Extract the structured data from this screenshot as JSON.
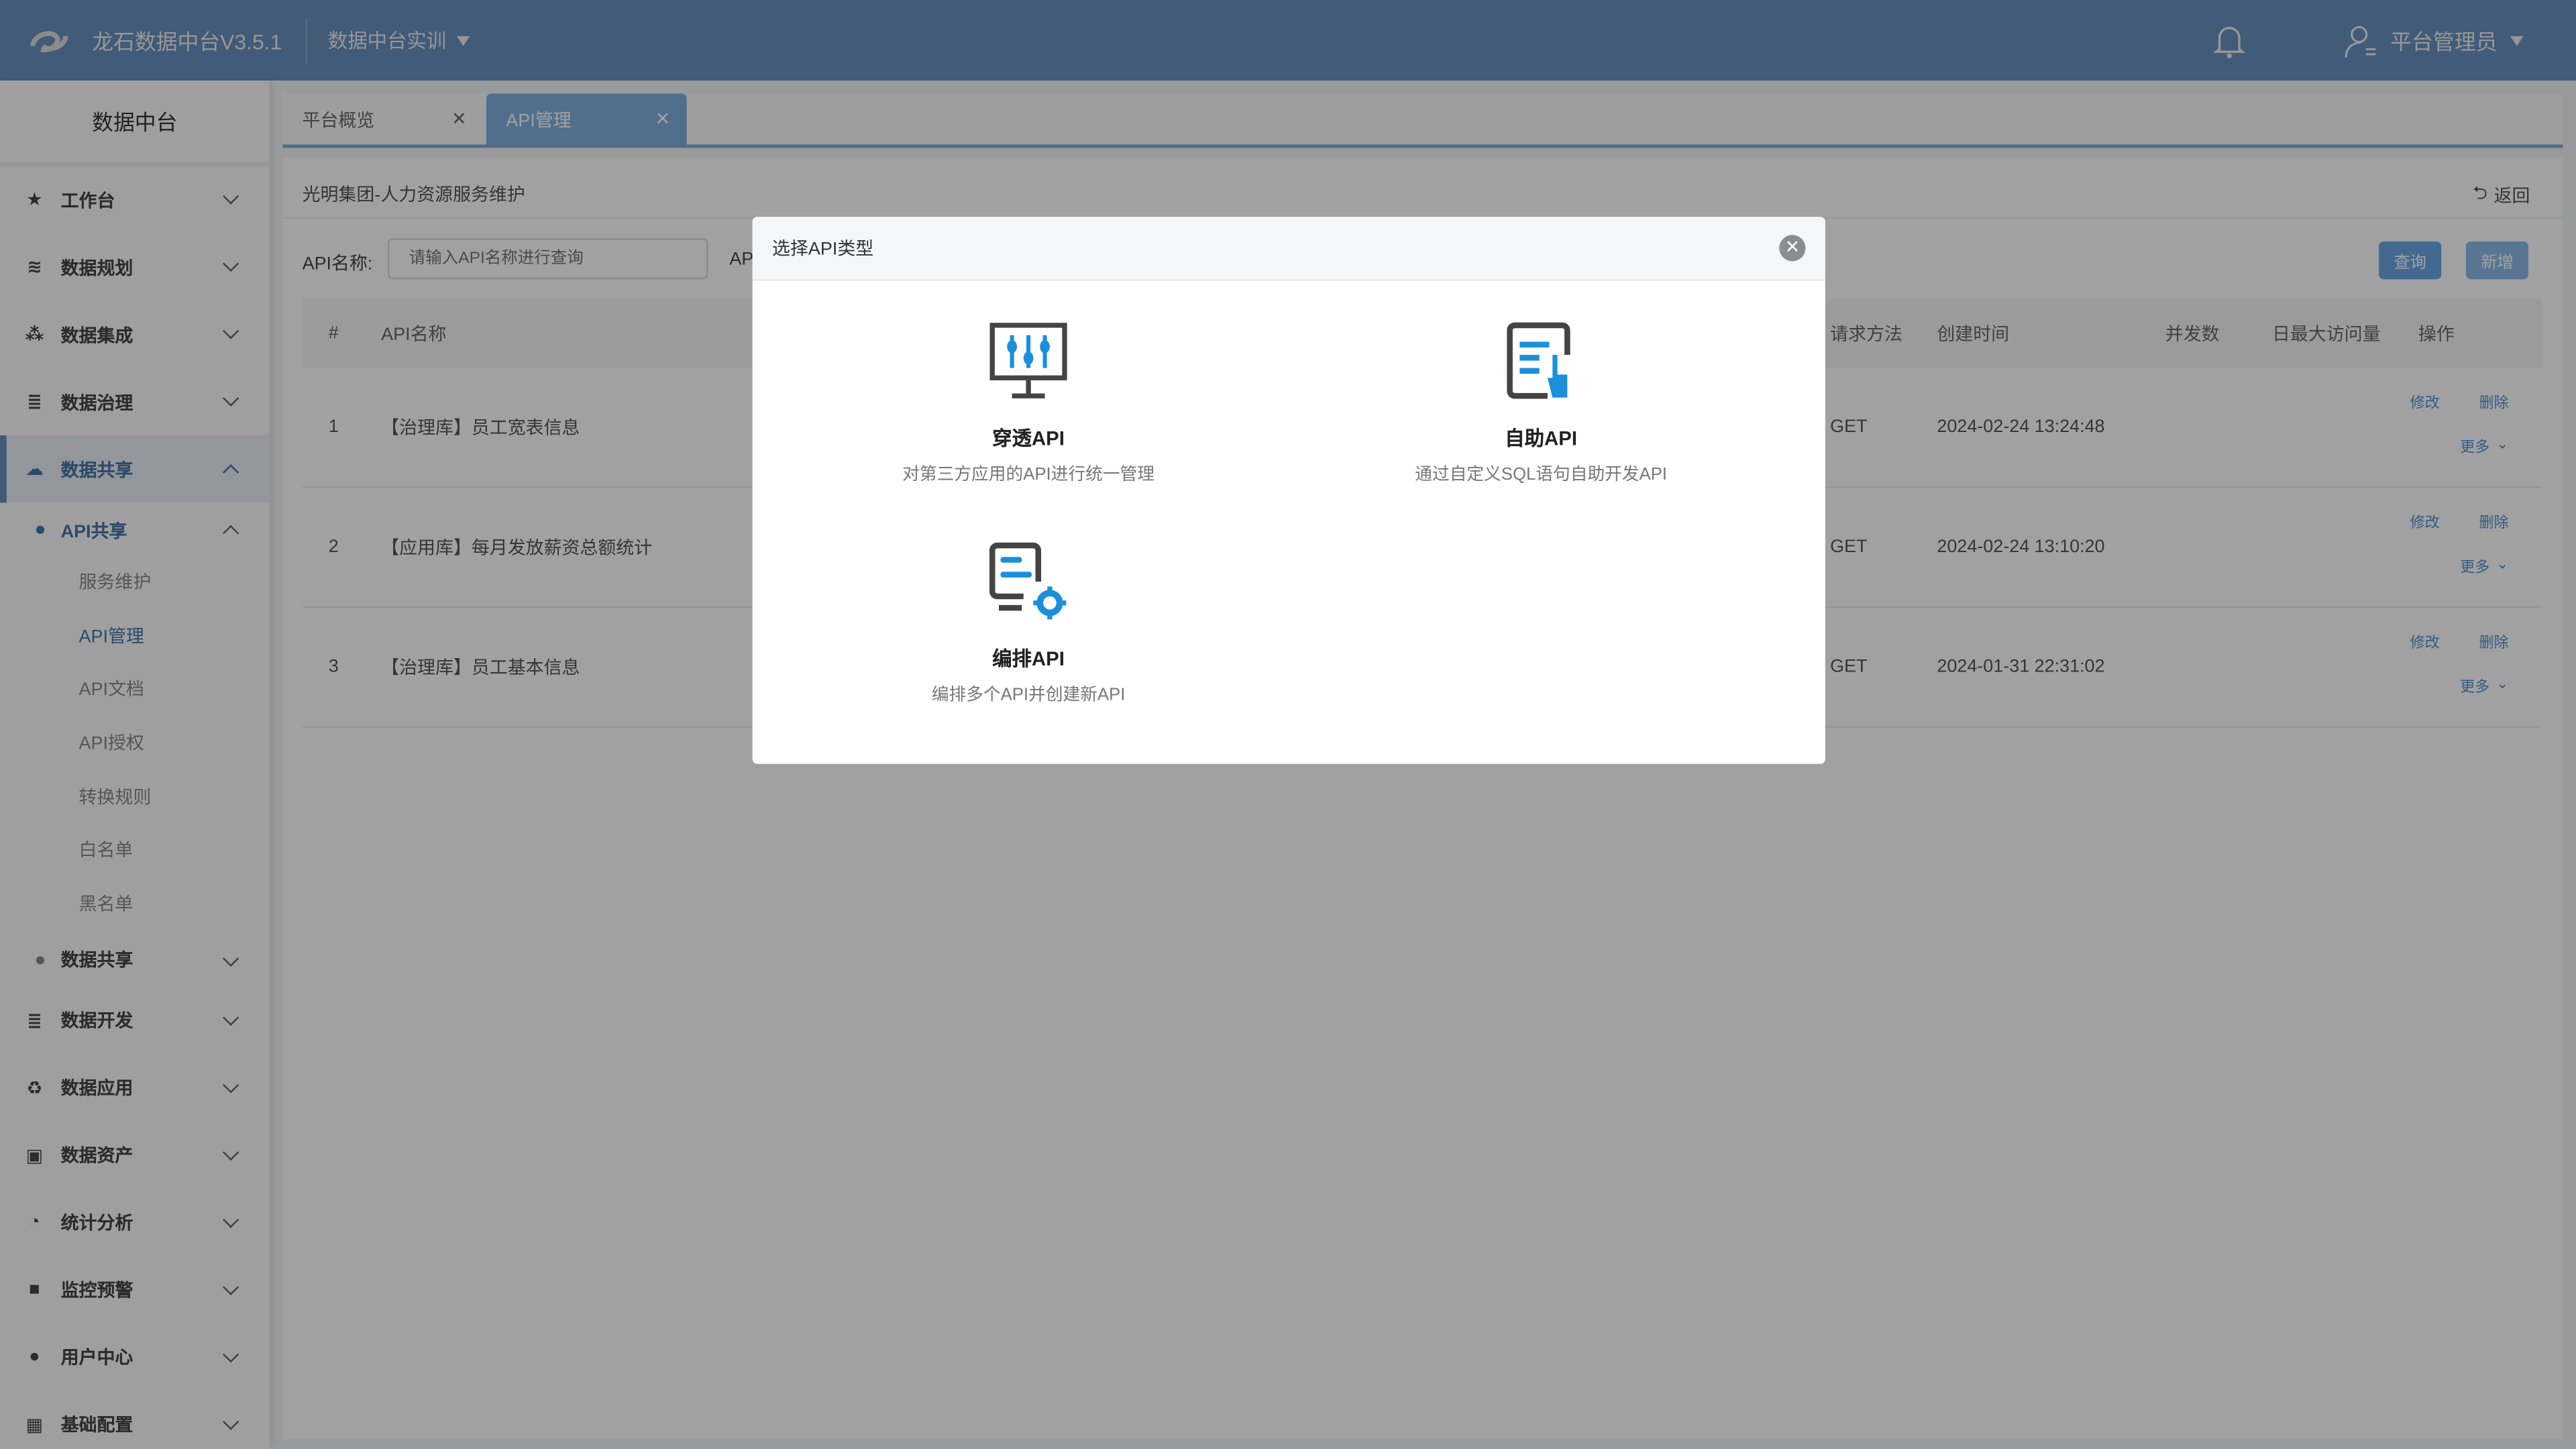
{
  "header": {
    "app_title": "龙石数据中台V3.5.1",
    "project": "数据中台实训",
    "user": "平台管理员",
    "icons": [
      "logo",
      "bell-icon",
      "user-icon",
      "caret-down-icon"
    ]
  },
  "sidebar": {
    "title": "数据中台",
    "items": [
      {
        "label": "工作台",
        "icon": "star-icon"
      },
      {
        "label": "数据规划",
        "icon": "layers-icon"
      },
      {
        "label": "数据集成",
        "icon": "cubes-icon"
      },
      {
        "label": "数据治理",
        "icon": "database-icon"
      },
      {
        "label": "数据共享",
        "icon": "cloud-icon",
        "active": true
      },
      {
        "label": "数据开发",
        "icon": "database-code-icon"
      },
      {
        "label": "数据应用",
        "icon": "recycle-icon"
      },
      {
        "label": "数据资产",
        "icon": "asset-icon"
      },
      {
        "label": "统计分析",
        "icon": "pie-icon"
      },
      {
        "label": "监控预警",
        "icon": "camera-icon"
      },
      {
        "label": "用户中心",
        "icon": "user-icon"
      },
      {
        "label": "基础配置",
        "icon": "grid-icon"
      }
    ],
    "sub": {
      "api_share": "API共享",
      "leaves": [
        "服务维护",
        "API管理",
        "API文档",
        "API授权",
        "转换规则",
        "白名单",
        "黑名单"
      ],
      "data_share": "数据共享"
    }
  },
  "tabs": [
    {
      "label": "平台概览"
    },
    {
      "label": "API管理",
      "active": true
    }
  ],
  "page": {
    "breadcrumb": "光明集团-人力资源服务维护",
    "back": "返回",
    "filter_label": "API名称:",
    "filter_placeholder": "请输入API名称进行查询",
    "filter_label2": "AP",
    "query": "查询",
    "add": "新增"
  },
  "table": {
    "headers": [
      "#",
      "API名称",
      "请求方法",
      "创建时间",
      "并发数",
      "日最大访问量",
      "操作"
    ],
    "rows": [
      {
        "no": "1",
        "name": "【治理库】员工宽表信息",
        "method": "GET",
        "created": "2024-02-24 13:24:48"
      },
      {
        "no": "2",
        "name": "【应用库】每月发放薪资总额统计",
        "method": "GET",
        "created": "2024-02-24 13:10:20"
      },
      {
        "no": "3",
        "name": "【治理库】员工基本信息",
        "method": "GET",
        "created": "2024-01-31 22:31:02"
      }
    ],
    "ops": {
      "edit": "修改",
      "delete": "删除",
      "more": "更多"
    }
  },
  "modal": {
    "title": "选择API类型",
    "options": [
      {
        "title": "穿透API",
        "desc": "对第三方应用的API进行统一管理",
        "icon": "monitor-sliders-icon"
      },
      {
        "title": "自助API",
        "desc": "通过自定义SQL语句自助开发API",
        "icon": "document-hand-icon"
      },
      {
        "title": "编排API",
        "desc": "编排多个API并创建新API",
        "icon": "document-gear-icon"
      }
    ]
  },
  "colors": {
    "header": "#6891bf",
    "accent": "#4e90d6",
    "icon_blue": "#1a90dc",
    "overlay": "rgba(0,0,0,0.37)"
  }
}
